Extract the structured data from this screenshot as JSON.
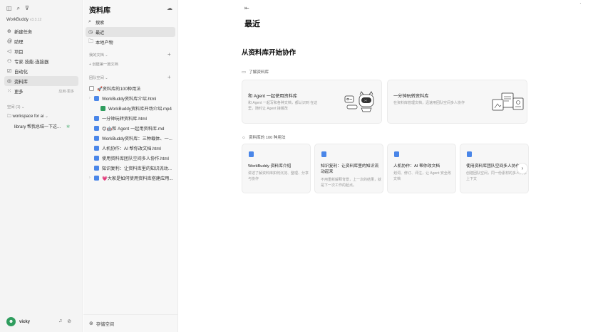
{
  "sidebar": {
    "brand": "WorkBuddy",
    "version": "v3.3.12",
    "nav": [
      {
        "label": "新建任务",
        "icon": "plus-circle-icon"
      },
      {
        "label": "助理",
        "icon": "at-icon"
      },
      {
        "label": "项目",
        "icon": "folder-icon"
      },
      {
        "label": "专家·技能·连接器",
        "icon": "expert-icon"
      },
      {
        "label": "自动化",
        "icon": "clock-icon"
      },
      {
        "label": "资料库",
        "icon": "library-icon"
      },
      {
        "label": "更多",
        "icon": "grid-icon"
      }
    ],
    "more_hint": "应用·更多",
    "spaces_label": "空间 (1)",
    "workspace": "workspace for ai",
    "workspace_item": "library 帮我总结一下这...",
    "user": "vicky"
  },
  "library": {
    "title": "资料库",
    "nav": [
      {
        "label": "搜索"
      },
      {
        "label": "最近"
      },
      {
        "label": "本地产物"
      }
    ],
    "my_docs_label": "我的文档",
    "create_first": "创建第一篇文档",
    "team_label": "团队空间",
    "docs": [
      {
        "label": "🚀资料库的100种用法",
        "type": "check"
      },
      {
        "label": "WorkBuddy资料库介绍.html",
        "type": "doc",
        "caret": "›"
      },
      {
        "label": "WorkBuddy资料库开场介绍.mp4",
        "type": "video",
        "sub": true
      },
      {
        "label": "一分钟玩转资料库.html",
        "type": "doc"
      },
      {
        "label": "😊🤖和 Agent 一起用资料库.md",
        "type": "doc"
      },
      {
        "label": "WorkBuddy资料库：三种载体、一...",
        "type": "doc"
      },
      {
        "label": "人机协作：AI 帮你改文档.html",
        "type": "doc"
      },
      {
        "label": "使用资料库团队空间多人协作.html",
        "type": "doc"
      },
      {
        "label": "知识复利：让资料库里的知识流动...",
        "type": "doc"
      },
      {
        "label": "💗大家是如何使用资料库搭建应用...",
        "type": "doc",
        "caret": "›"
      }
    ],
    "footer": "存储空间"
  },
  "main": {
    "title": "最近",
    "hero": "从资料库开始协作",
    "understand_label": "了解资料库",
    "big_cards": [
      {
        "title": "和 Agent 一起使用资料库",
        "desc": "和 Agent 一起写和各种文档，都认识到 在这里，随时让 Agent 接着改"
      },
      {
        "title": "一分钟玩转资料库",
        "desc": "在资料库管理文档，迅速用团队空间多人协作"
      }
    ],
    "uses_label": "资料库的 100 种用法",
    "small_cards": [
      {
        "title": "WorkBuddy 资料库介绍",
        "desc": "讲述了解资料库如何沉淀、整理、分享与协作"
      },
      {
        "title": "知识复利：让资料库里的知识流动起来",
        "desc": "不用重新解释背景，上一次的结果，就是下一次工作的起点。"
      },
      {
        "title": "人机协作：AI 帮你改文档",
        "desc": "划词、修订、评注，让 Agent 安全改文档"
      },
      {
        "title": "使用资料库团队空间多人协作",
        "desc": "创建团队空间，同一份素材的多人共享上下文"
      }
    ]
  },
  "colors": {
    "accent_blue": "#4a86e8",
    "accent_green": "#2f9d5e",
    "sidebar_bg": "#f4f4f4"
  }
}
